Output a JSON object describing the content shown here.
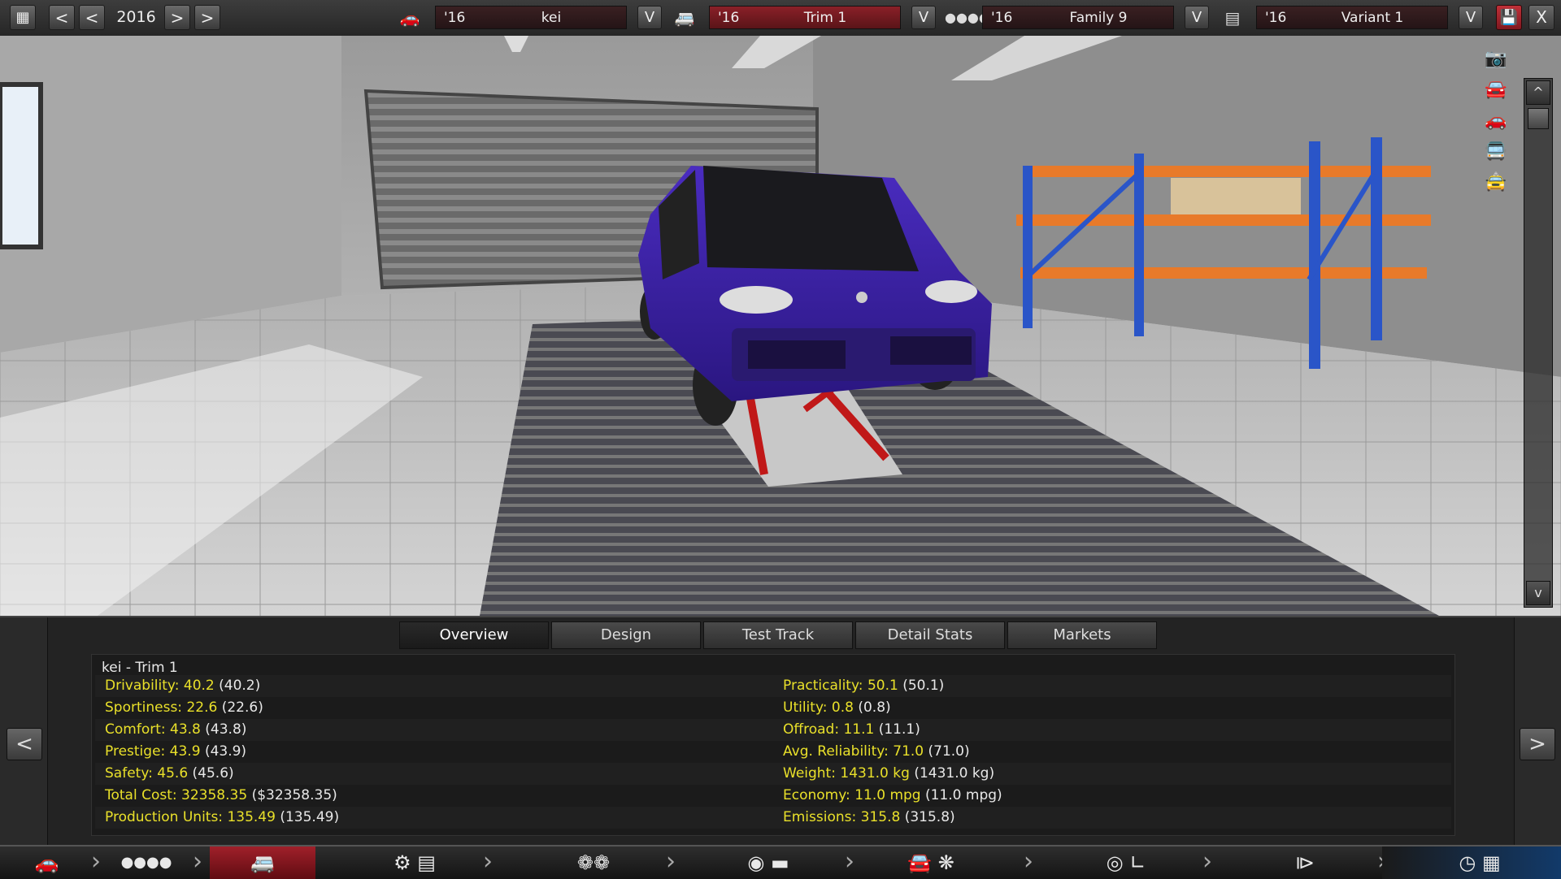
{
  "topbar": {
    "calendar_icon": "calendar-icon",
    "prev_fast": "<",
    "prev": "<",
    "year": "2016",
    "next": ">",
    "next_fast": ">",
    "model": {
      "year": "'16",
      "name": "kei",
      "icon": "car-model-icon"
    },
    "trim": {
      "year": "'16",
      "name": "Trim 1",
      "icon": "car-trim-icon"
    },
    "family": {
      "year": "'16",
      "name": "Family 9",
      "icon": "engine-family-icon"
    },
    "variant": {
      "year": "'16",
      "name": "Variant 1",
      "icon": "engine-variant-icon"
    },
    "dropdown": "V",
    "save_icon": "save-icon",
    "close": "X"
  },
  "viewport": {
    "tools": [
      "camera-icon",
      "car-front-icon",
      "car-side-icon",
      "car-rear-icon",
      "car-top-icon"
    ],
    "scroll_up": "^",
    "scroll_down": "v",
    "colors": {
      "car_body": "#3a1fa3",
      "rack_frame": "#2a55c8",
      "rack_shelf": "#e87a2a",
      "lift": "#c01818"
    }
  },
  "panel": {
    "tabs": [
      "Overview",
      "Design",
      "Test Track",
      "Detail Stats",
      "Markets"
    ],
    "active_tab": "Overview",
    "prev": "<",
    "next": ">",
    "title": "kei - Trim 1",
    "left_stats": [
      {
        "label": "Drivability:",
        "value": "40.2",
        "paren": "(40.2)"
      },
      {
        "label": "Sportiness:",
        "value": "22.6",
        "paren": "(22.6)"
      },
      {
        "label": "Comfort:",
        "value": "43.8",
        "paren": "(43.8)"
      },
      {
        "label": "Prestige:",
        "value": "43.9",
        "paren": "(43.9)"
      },
      {
        "label": "Safety:",
        "value": "45.6",
        "paren": "(45.6)"
      },
      {
        "label": "Total Cost:",
        "value": "32358.35",
        "paren": "($32358.35)"
      },
      {
        "label": "Production Units:",
        "value": "135.49",
        "paren": "(135.49)"
      }
    ],
    "right_stats": [
      {
        "label": "Practicality:",
        "value": "50.1",
        "paren": "(50.1)"
      },
      {
        "label": "Utility:",
        "value": "0.8",
        "paren": "(0.8)"
      },
      {
        "label": "Offroad:",
        "value": "11.1",
        "paren": "(11.1)"
      },
      {
        "label": "Avg. Reliability:",
        "value": "71.0",
        "paren": "(71.0)"
      },
      {
        "label": "Weight:",
        "value": "1431.0 kg",
        "paren": "(1431.0 kg)"
      },
      {
        "label": "Economy:",
        "value": "11.0 mpg",
        "paren": "(11.0 mpg)"
      },
      {
        "label": "Emissions:",
        "value": "315.8",
        "paren": "(315.8)"
      }
    ]
  },
  "bottombar": {
    "steps": [
      "car-model-icon",
      "engine-family-icon",
      "car-trim-icon",
      "engine-gearbox-icon",
      "wheels-icon",
      "body-design-icon",
      "aero-fan-icon",
      "interior-icon",
      "suspension-icon",
      "test-track-icon"
    ]
  }
}
